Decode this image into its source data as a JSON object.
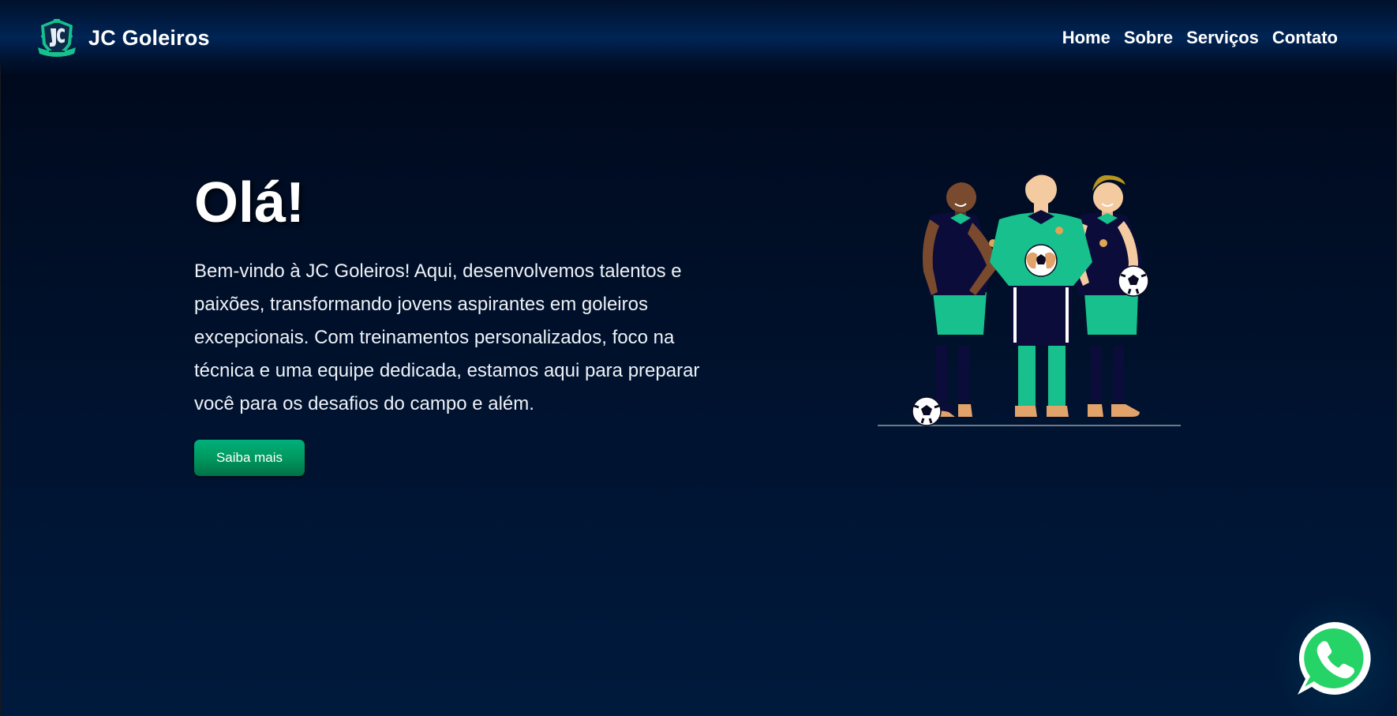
{
  "header": {
    "logo_icon": "jc-goleiros-crest-icon",
    "brand_name": "JC Goleiros",
    "nav": [
      {
        "label": "Home"
      },
      {
        "label": "Sobre"
      },
      {
        "label": "Serviços"
      },
      {
        "label": "Contato"
      }
    ]
  },
  "hero": {
    "title": "Olá!",
    "body": "Bem-vindo à JC Goleiros! Aqui, desenvolvemos talentos e paixões, transformando jovens aspirantes em goleiros excepcionais. Com treinamentos personalizados, foco na técnica e uma equipe dedicada, estamos aqui para preparar você para os desafios do campo e além.",
    "cta_label": "Saiba mais",
    "illustration_icon": "goalkeeper-players-illustration"
  },
  "floating": {
    "whatsapp_icon": "whatsapp-icon"
  },
  "colors": {
    "background_top": "#00081a",
    "background_bottom": "#001a3d",
    "header_band": "#002455",
    "cta_green": "#00995f",
    "jersey_green": "#17c08c",
    "jersey_navy": "#0c0c3a",
    "whatsapp_green": "#25d366"
  }
}
